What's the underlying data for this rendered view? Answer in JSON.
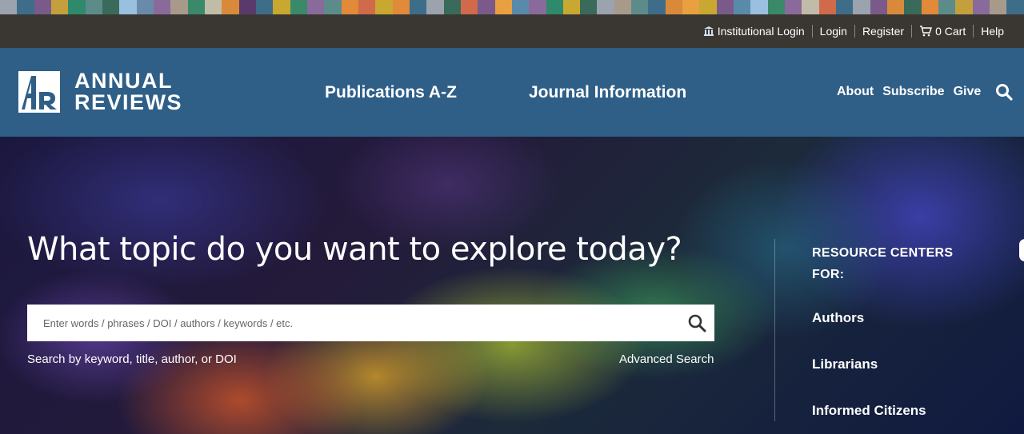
{
  "stripe_colors": [
    "#9aa3ae",
    "#3e6d8a",
    "#7a5a8a",
    "#c4a03c",
    "#2e8a6a",
    "#5c8c8a",
    "#3a6a5a",
    "#9ac0e0",
    "#6a8aaa",
    "#8a6a9a",
    "#a89a8a",
    "#3a8a6a",
    "#c0bca8",
    "#d88a3a",
    "#5a3a6a",
    "#3e6d8a",
    "#c8a830",
    "#3a8a6a",
    "#8a6a9a",
    "#5c8c8a",
    "#e08a3a",
    "#d06a4a",
    "#c8a830",
    "#e08a3a",
    "#3e6d8a",
    "#9aa3ae",
    "#3a6a5a",
    "#d06a4a",
    "#7a5a8a",
    "#e8a040",
    "#5a8aaa",
    "#8a6a9a",
    "#2e8a6a",
    "#c8a830",
    "#3a6a5a",
    "#9aa3ae",
    "#a89a8a",
    "#5c8c8a",
    "#3e6d8a",
    "#d88a3a",
    "#e8a040",
    "#c8a830",
    "#7a5a8a",
    "#5a8aaa",
    "#9ac0e0",
    "#3a8a6a",
    "#8a6a9a",
    "#c0bca8",
    "#d06a4a",
    "#3e6d8a",
    "#9aa3ae",
    "#7a5a8a",
    "#d88a3a",
    "#3a6a5a",
    "#e08a3a",
    "#5c8c8a",
    "#c4a03c",
    "#8a6a9a",
    "#a89a8a",
    "#3e6d8a"
  ],
  "utility": {
    "institutional_login": "Institutional Login",
    "login": "Login",
    "register": "Register",
    "cart": "0 Cart",
    "help": "Help"
  },
  "brand": {
    "line1": "ANNUAL",
    "line2": "REVIEWS"
  },
  "nav": {
    "publications": "Publications A-Z",
    "journal_info": "Journal Information",
    "about": "About",
    "subscribe": "Subscribe",
    "give": "Give"
  },
  "hero": {
    "headline": "What topic do you want to explore today?",
    "search_placeholder": "Enter words / phrases / DOI / authors / keywords / etc.",
    "hint": "Search by keyword, title, author, or DOI",
    "advanced": "Advanced Search"
  },
  "resources": {
    "title": "RESOURCE CENTERS FOR:",
    "items": [
      "Authors",
      "Librarians",
      "Informed Citizens"
    ]
  }
}
